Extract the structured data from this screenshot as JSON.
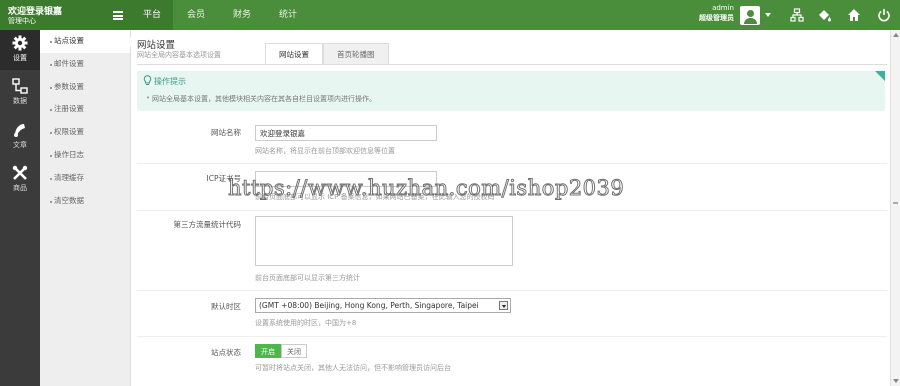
{
  "brand": {
    "title": "欢迎登录银嘉",
    "subtitle": "管理中心"
  },
  "topnav": {
    "items": [
      {
        "label": "平台"
      },
      {
        "label": "会员"
      },
      {
        "label": "财务"
      },
      {
        "label": "统计"
      }
    ]
  },
  "user": {
    "name": "admin",
    "role": "超级管理员"
  },
  "leftbar": {
    "items": [
      {
        "label": "设置",
        "icon": "gear-icon"
      },
      {
        "label": "数据",
        "icon": "sitemap-icon"
      },
      {
        "label": "文章",
        "icon": "article-icon"
      },
      {
        "label": "商品",
        "icon": "tools-icon"
      }
    ]
  },
  "submenu": {
    "items": [
      {
        "label": "站点设置"
      },
      {
        "label": "邮件设置"
      },
      {
        "label": "参数设置"
      },
      {
        "label": "注册设置"
      },
      {
        "label": "权限设置"
      },
      {
        "label": "操作日志"
      },
      {
        "label": "清理缓存"
      },
      {
        "label": "清空数据"
      }
    ]
  },
  "page": {
    "title": "网站设置",
    "subtitle": "网站全局内容基本选项设置"
  },
  "tabs": [
    {
      "label": "网站设置"
    },
    {
      "label": "首页轮播图"
    }
  ],
  "tip": {
    "title": "操作提示",
    "text": "网站全局基本设置，其他模块相关内容在其各自栏目设置项内进行操作。"
  },
  "form": {
    "site_name": {
      "label": "网站名称",
      "value": "欢迎登录银嘉",
      "hint": "网站名称，将显示在前台顶部欢迎信息等位置"
    },
    "icp": {
      "label": "ICP证书号",
      "value": "",
      "hint": "前台页面底部可以显示 ICP 备案信息，如果网站已备案，在此输入您的授权码"
    },
    "stats": {
      "label": "第三方流量统计代码",
      "hint": "前台页面底部可以显示第三方统计"
    },
    "timezone": {
      "label": "默认时区",
      "value": "(GMT +08:00) Beijing, Hong Kong, Perth, Singapore, Taipei",
      "hint": "设置系统使用的时区，中国为+8"
    },
    "status": {
      "label": "站点状态",
      "on": "开启",
      "off": "关闭",
      "hint": "可暂时将站点关闭，其他人无法访问，但不影响管理员访问后台"
    }
  },
  "watermark": "https://www.huzhan.com/ishop2039",
  "colors": {
    "topbar": "#4a8d3a",
    "sidebar": "#3b3b3b",
    "tip_bg": "#e8f6f2",
    "toggle_on": "#4cb84c"
  }
}
